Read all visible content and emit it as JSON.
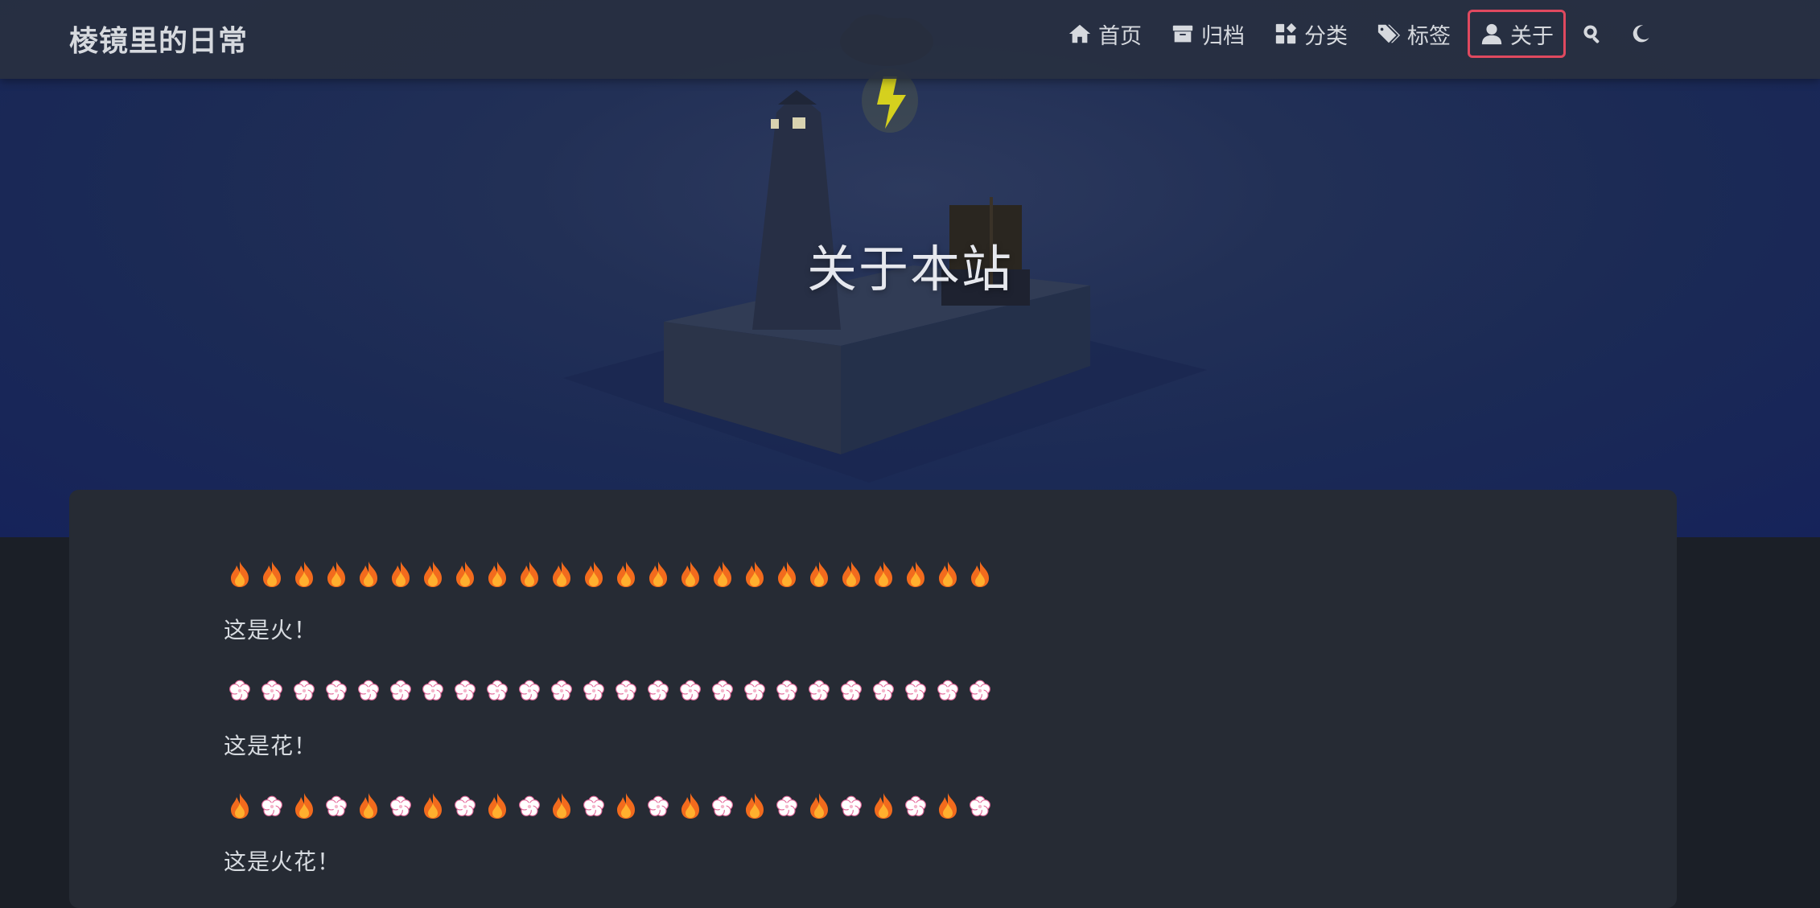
{
  "site": {
    "brand": "棱镜里的日常"
  },
  "nav": {
    "items": [
      {
        "label": "首页",
        "icon": "home-icon"
      },
      {
        "label": "归档",
        "icon": "archive-icon"
      },
      {
        "label": "分类",
        "icon": "category-icon"
      },
      {
        "label": "标签",
        "icon": "tags-icon"
      },
      {
        "label": "关于",
        "icon": "user-icon",
        "active": true
      }
    ],
    "search_icon": "search-icon",
    "theme_icon": "moon-icon",
    "active_border_color": "#e0495f"
  },
  "hero": {
    "title": "关于本站"
  },
  "content": {
    "row1": {
      "pattern": "fire",
      "count": 24
    },
    "para1": "这是火！",
    "row2": {
      "pattern": "flower",
      "count": 24
    },
    "para2": "这是花！",
    "row3": {
      "pattern": "alternate",
      "count": 24
    },
    "para3": "这是火花！"
  },
  "colors": {
    "background": "#1b1f27",
    "card": "#262b34",
    "navbar": "#283040",
    "text": "#d7dbe0"
  }
}
